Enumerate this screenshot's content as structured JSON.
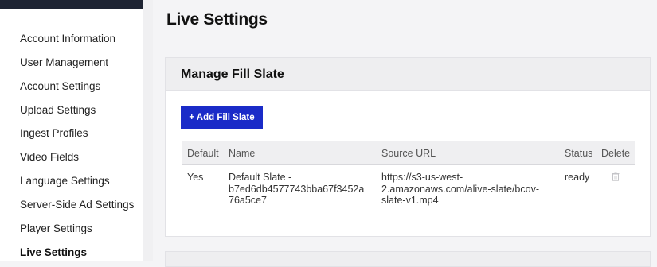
{
  "sidebar": {
    "items": [
      {
        "label": "Account Information",
        "active": false
      },
      {
        "label": "User Management",
        "active": false
      },
      {
        "label": "Account Settings",
        "active": false
      },
      {
        "label": "Upload Settings",
        "active": false
      },
      {
        "label": "Ingest Profiles",
        "active": false
      },
      {
        "label": "Video Fields",
        "active": false
      },
      {
        "label": "Language Settings",
        "active": false
      },
      {
        "label": "Server-Side Ad Settings",
        "active": false
      },
      {
        "label": "Player Settings",
        "active": false
      },
      {
        "label": "Live Settings",
        "active": true
      }
    ]
  },
  "page": {
    "title": "Live Settings"
  },
  "fill_slate": {
    "title": "Manage Fill Slate",
    "add_button": "+ Add Fill Slate",
    "columns": [
      "Default",
      "Name",
      "Source URL",
      "Status",
      "Delete"
    ],
    "rows": [
      {
        "default": "Yes",
        "name_lines": [
          "Default Slate -",
          "b7ed6db4577743bba67f3452a",
          "76a5ce7"
        ],
        "url_lines": [
          "https://s3-us-west-",
          "2.amazonaws.com/alive-slate/bcov-",
          "slate-v1.mp4"
        ],
        "status": "ready",
        "delete_icon": "trash-icon"
      }
    ]
  },
  "colors": {
    "accent": "#1a2bc8",
    "sidebar_top": "#1e2433"
  }
}
